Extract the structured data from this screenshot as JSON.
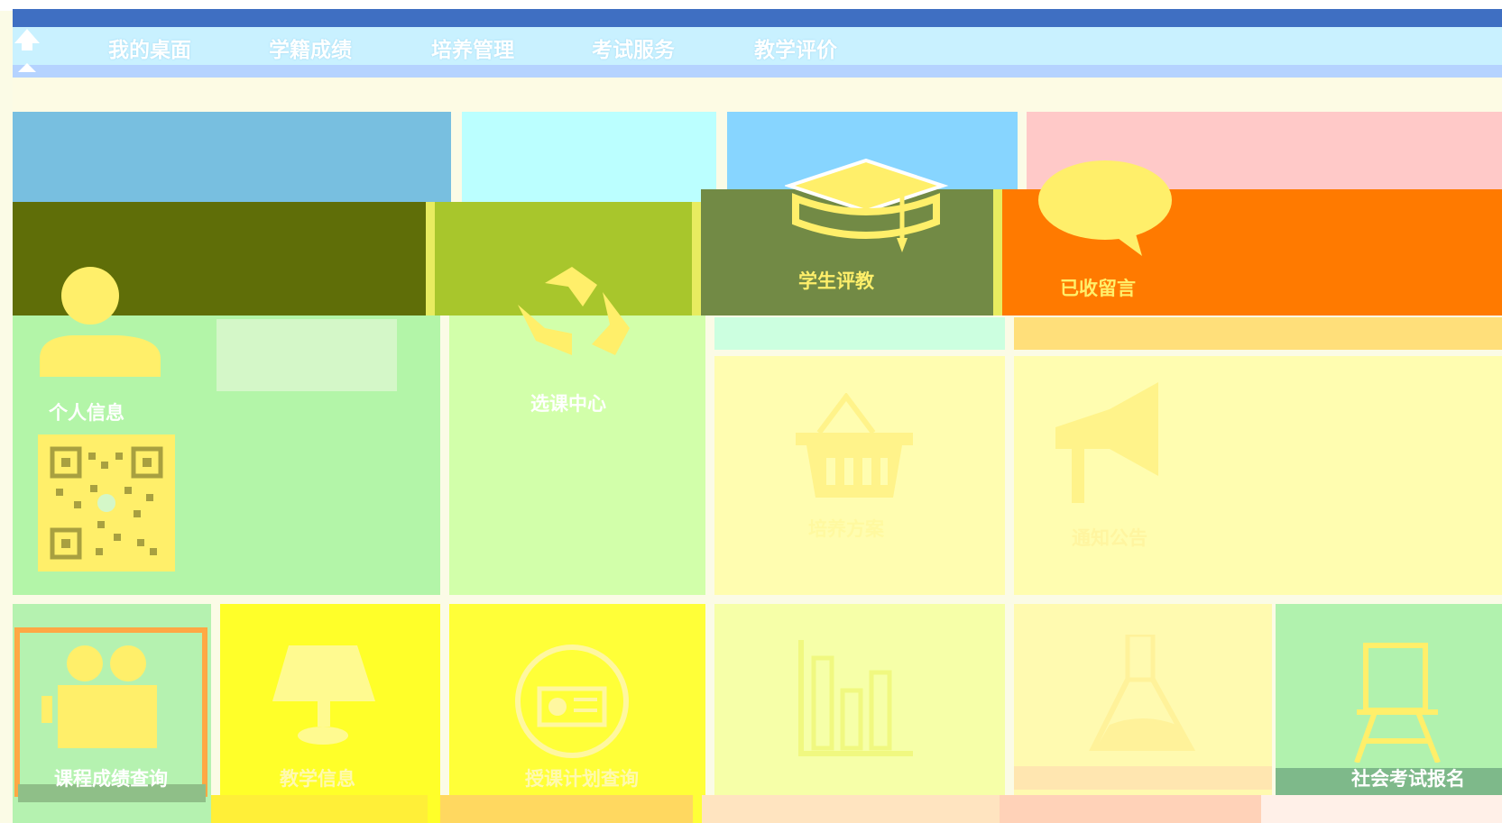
{
  "nav": {
    "items": [
      {
        "label": "我的桌面"
      },
      {
        "label": "学籍成绩"
      },
      {
        "label": "培养管理"
      },
      {
        "label": "考试服务"
      },
      {
        "label": "教学评价"
      }
    ]
  },
  "tiles": {
    "student_eval": {
      "label": "学生评教",
      "icon": "graduation-cap-icon"
    },
    "messages": {
      "label": "已收留言",
      "icon": "speech-bubble-icon"
    },
    "personal_info": {
      "label": "个人信息",
      "icon": "user-icon"
    },
    "recycle": {
      "label": "选课中心",
      "icon": "recycle-icon"
    },
    "shopping": {
      "label": "培养方案",
      "icon": "basket-icon"
    },
    "notice": {
      "label": "通知公告",
      "icon": "megaphone-icon"
    },
    "course_grade": {
      "label": "课程成绩查询",
      "icon": "video-camera-icon"
    },
    "teaching_info": {
      "label": "教学信息",
      "icon": "lamp-icon"
    },
    "plan_query": {
      "label": "授课计划查询",
      "icon": "radio-icon"
    },
    "statistics": {
      "label": "",
      "icon": "bar-chart-icon"
    },
    "lab": {
      "label": "",
      "icon": "flask-icon"
    },
    "social_exam": {
      "label": "社会考试报名",
      "icon": "easel-icon"
    }
  },
  "colors": {
    "nav_bg": "#c9f1ff",
    "orange": "#ff7a00",
    "olive": "#5f6e08",
    "lime": "#a8c62c",
    "dark_olive": "#728a45",
    "yellow_icon": "#ffef6a"
  }
}
